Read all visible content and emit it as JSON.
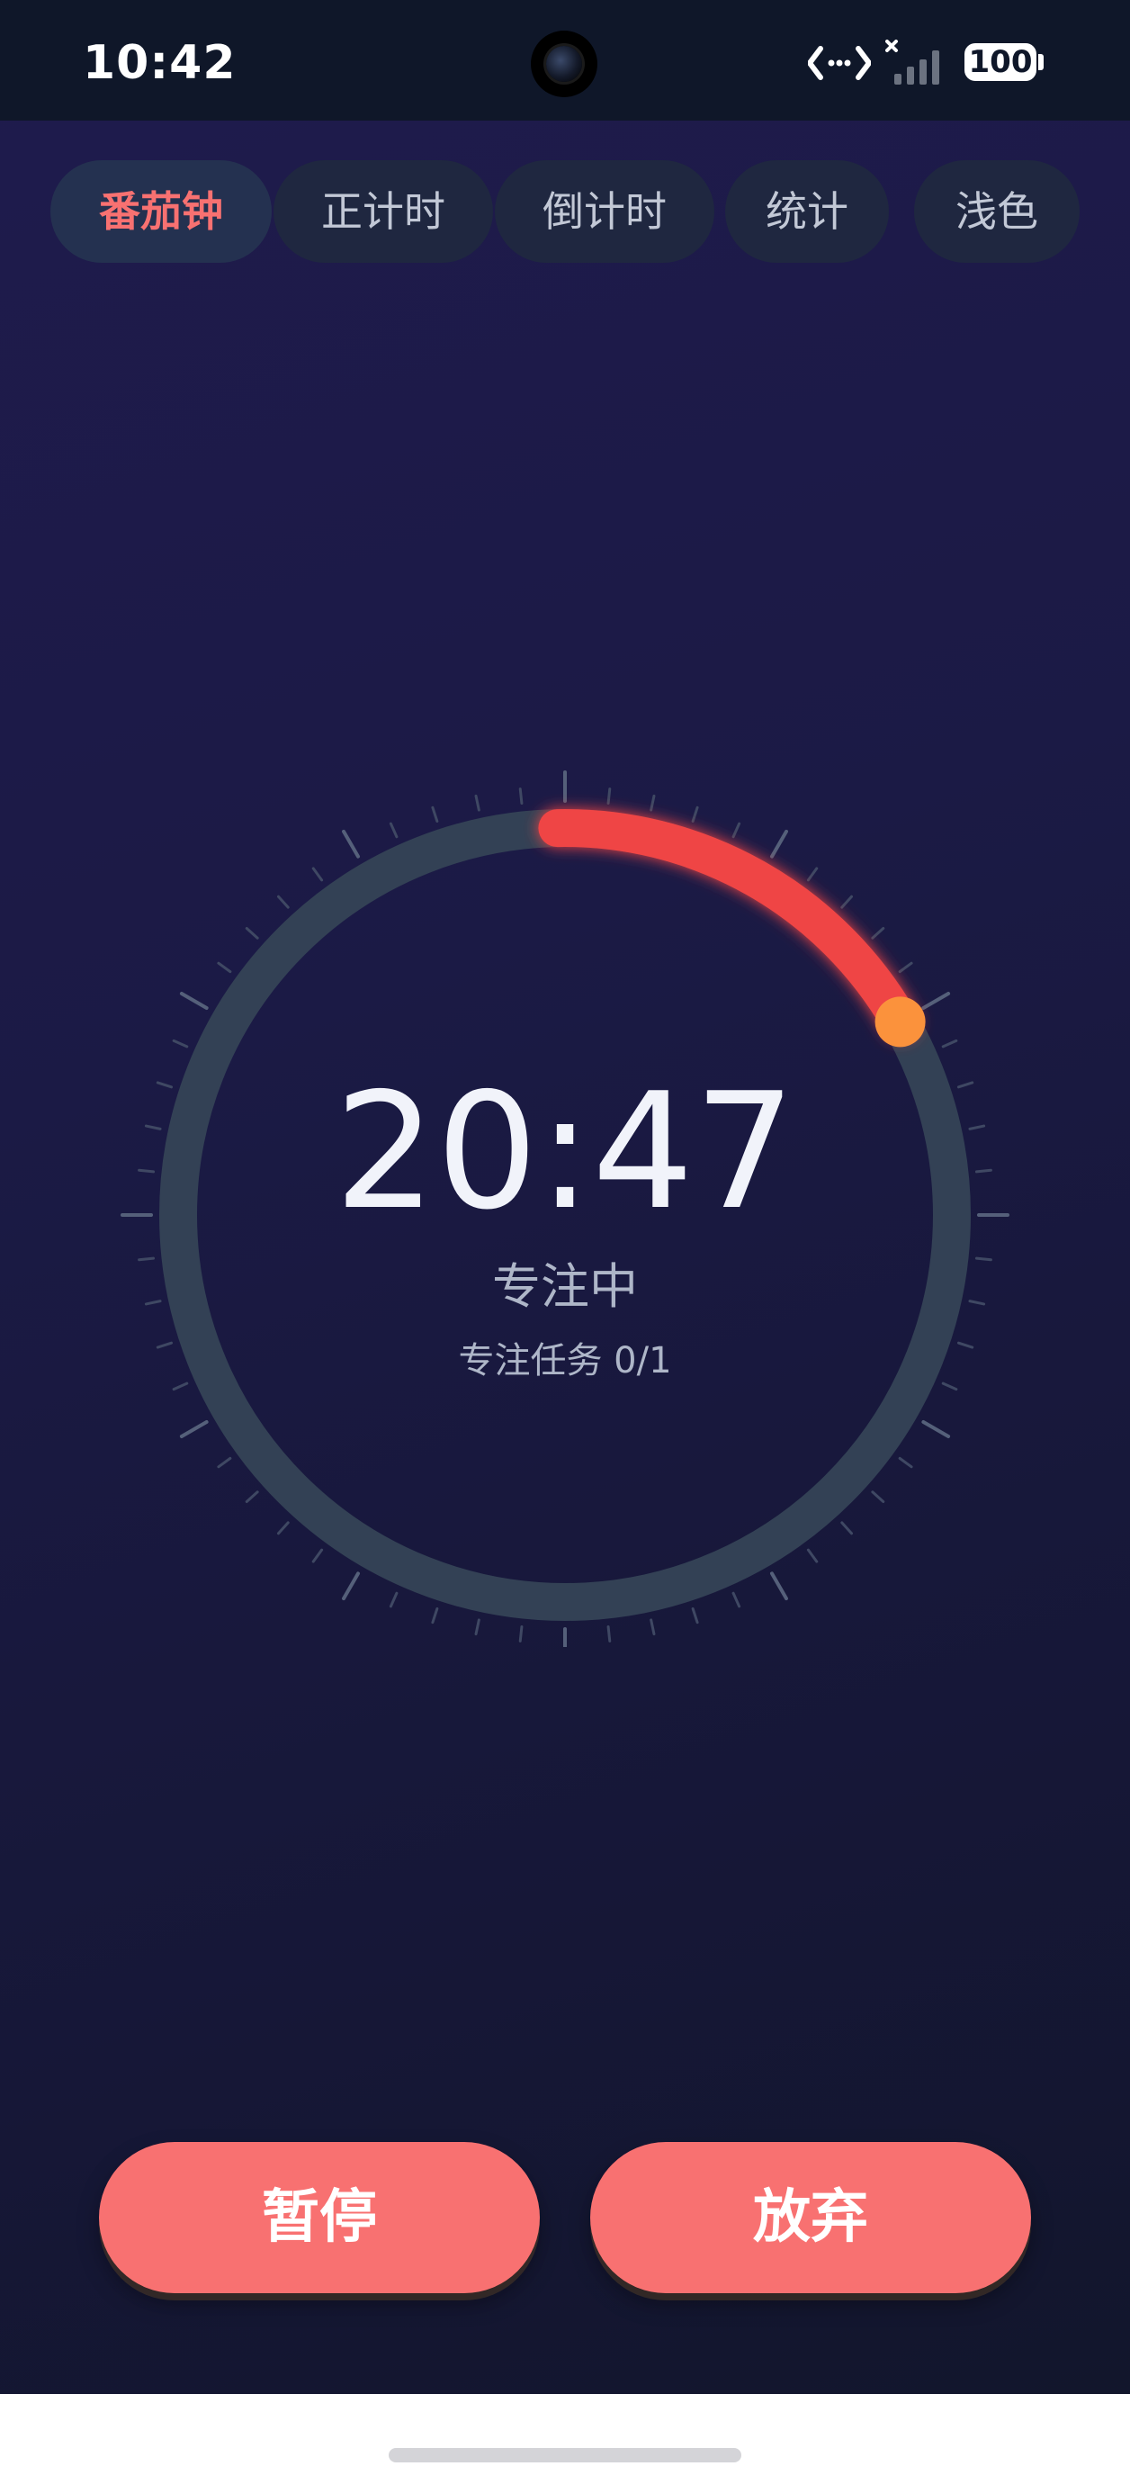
{
  "status_bar": {
    "time": "10:42",
    "battery": "100",
    "icons": [
      "camera-icon",
      "data-transfer-icon",
      "signal-icon",
      "battery-icon"
    ]
  },
  "tabs": [
    {
      "label": "番茄钟",
      "active": true
    },
    {
      "label": "正计时",
      "active": false
    },
    {
      "label": "倒计时",
      "active": false
    },
    {
      "label": "统计",
      "active": false
    },
    {
      "label": "浅色",
      "active": false
    }
  ],
  "timer": {
    "display": "20:47",
    "status": "专注中",
    "task": "专注任务 0/1",
    "progress_fraction": 0.17
  },
  "buttons": {
    "pause": "暂停",
    "abandon": "放弃"
  },
  "colors": {
    "accent": "#f87171",
    "progress": "#ef4444",
    "knob": "#fb923c",
    "track": "#334155"
  }
}
